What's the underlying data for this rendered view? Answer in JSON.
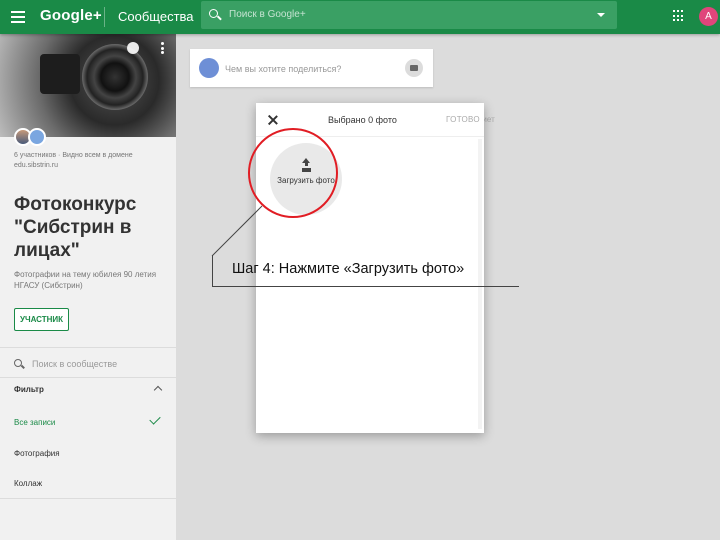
{
  "topbar": {
    "logo": "Google+",
    "section": "Сообщества",
    "search_placeholder": "Поиск в Google+",
    "avatar_letter": "А",
    "color": "#1a8a47"
  },
  "sidebar": {
    "members_text": "6 участников · Видно всем в домене edu.sibstrin.ru",
    "title": "Фотоконкурс \"Сибстрин в лицах\"",
    "description": "Фотографии на тему юбилея 90 летия НГАСУ (Сибстрин)",
    "member_button": "УЧАСТНИК",
    "search_placeholder": "Поиск в сообществе",
    "filter_label": "Фильтр",
    "filters": [
      "Все записи",
      "Фотография",
      "Коллаж"
    ]
  },
  "main": {
    "share_placeholder": "Чем вы хотите поделиться?",
    "ghost_text": "ниет"
  },
  "dialog": {
    "title": "Выбрано 0 фото",
    "done_label": "ГОТОВО",
    "upload_label": "Загрузить фото"
  },
  "annotation": {
    "text": "Шаг 4: Нажмите «Загрузить фото»",
    "ring_color": "#e11d24"
  }
}
